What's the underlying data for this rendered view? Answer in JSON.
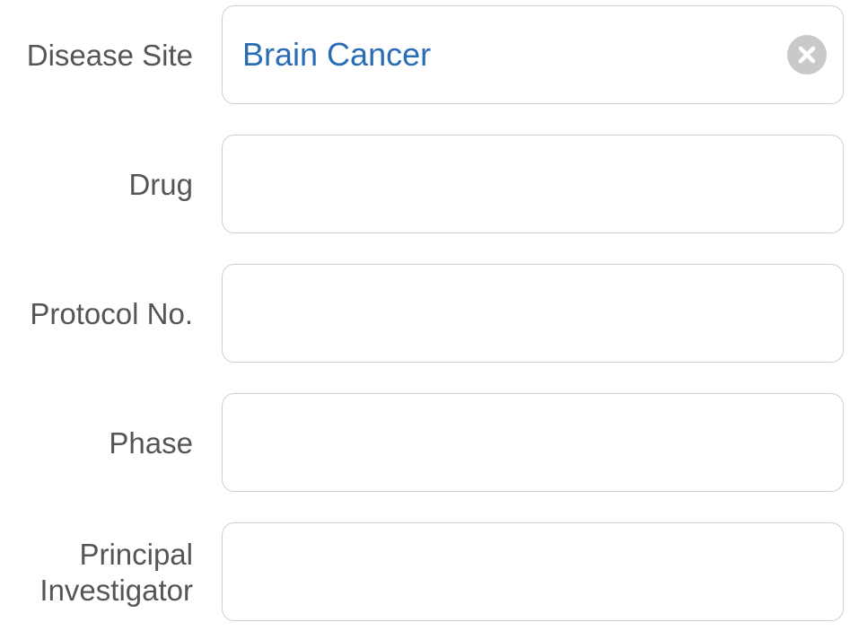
{
  "form": {
    "fields": [
      {
        "label": "Disease Site",
        "value": "Brain Cancer"
      },
      {
        "label": "Drug",
        "value": ""
      },
      {
        "label": "Protocol No.",
        "value": ""
      },
      {
        "label": "Phase",
        "value": ""
      },
      {
        "label_line1": "Principal",
        "label_line2": "Investigator",
        "value": ""
      }
    ]
  },
  "colors": {
    "label": "#555555",
    "value": "#2a6db4",
    "border": "#cfcfcf",
    "clear_button": "#c9c9c9"
  },
  "icons": {
    "clear": "clear-circle-x-icon"
  }
}
